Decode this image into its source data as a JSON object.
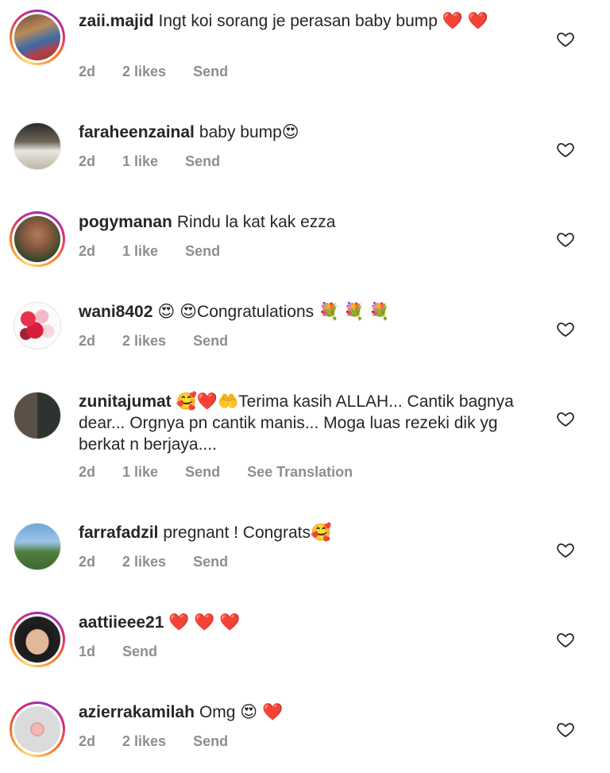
{
  "comments": [
    {
      "username": "zaii.majid",
      "text": "Ingt koi sorang je perasan baby bump ❤️ ❤️",
      "time": "2d",
      "likes": "2 likes",
      "send": "Send",
      "ring": true
    },
    {
      "username": "faraheenzainal",
      "text": "baby bump😍",
      "time": "2d",
      "likes": "1 like",
      "send": "Send",
      "ring": false
    },
    {
      "username": "pogymanan",
      "text": "Rindu la kat kak ezza",
      "time": "2d",
      "likes": "1 like",
      "send": "Send",
      "ring": true
    },
    {
      "username": "wani8402",
      "text": "😍 😍Congratulations 💐 💐 💐",
      "time": "2d",
      "likes": "2 likes",
      "send": "Send",
      "ring": false
    },
    {
      "username": "zunitajumat",
      "text": "🥰❤️🤲Terima kasih ALLAH... Cantik bagnya dear... Orgnya pn cantik manis... Moga luas rezeki dik yg berkat n berjaya....",
      "time": "2d",
      "likes": "1 like",
      "send": "Send",
      "see_translation": "See Translation",
      "ring": false
    },
    {
      "username": "farrafadzil",
      "text": "pregnant ! Congrats🥰",
      "time": "2d",
      "likes": "2 likes",
      "send": "Send",
      "ring": false
    },
    {
      "username": "aattiieee21",
      "text": "❤️ ❤️ ❤️",
      "time": "1d",
      "send": "Send",
      "ring": true
    },
    {
      "username": "azierrakamilah",
      "text": "Omg 😍 ❤️",
      "time": "2d",
      "likes": "2 likes",
      "send": "Send",
      "ring": true
    }
  ],
  "icons": {
    "like": "heart-outline-icon"
  },
  "colors": {
    "meta": "#8e8e8e",
    "text": "#262626",
    "heart_emoji": "#e0201e"
  }
}
